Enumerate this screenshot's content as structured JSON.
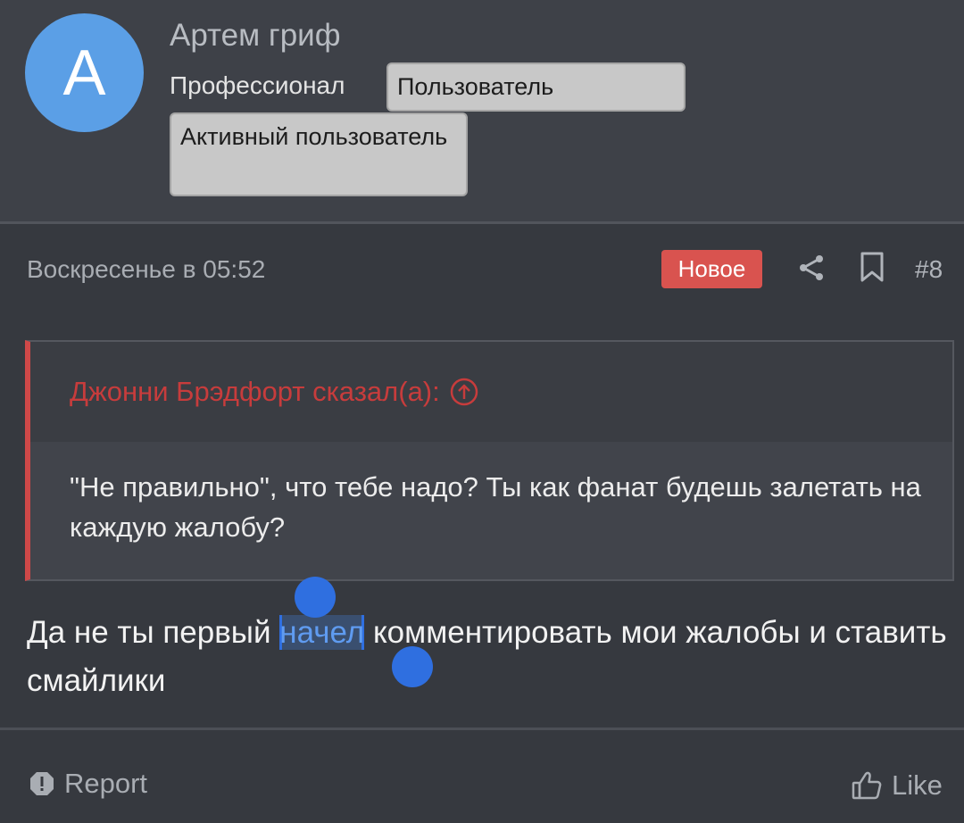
{
  "user": {
    "avatar_letter": "А",
    "name": "Артем гриф",
    "title": "Профессионал",
    "banners": [
      "Пользователь",
      "Активный пользователь"
    ]
  },
  "post": {
    "date": "Воскресенье в 05:52",
    "new_badge": "Новое",
    "number": "#8",
    "icons": [
      "share-icon",
      "bookmark-icon"
    ]
  },
  "quote": {
    "author": "Джонни Брэдфорт сказал(а):",
    "text": "\"Не правильно\", что тебе надо? Ты как фанат будешь залетать на каждую жалобу?"
  },
  "message": {
    "before": "Да не ты первый ",
    "selected": "начел",
    "after": " комментировать мои жалобы и ставить смайлики"
  },
  "actions": {
    "report": "Report",
    "like": "Like"
  },
  "colors": {
    "background": "#36393f",
    "avatar": "#5b9fe6",
    "new_badge": "#d9534f",
    "quote_accent": "#cf4848",
    "selection": "#2f6fe0"
  }
}
